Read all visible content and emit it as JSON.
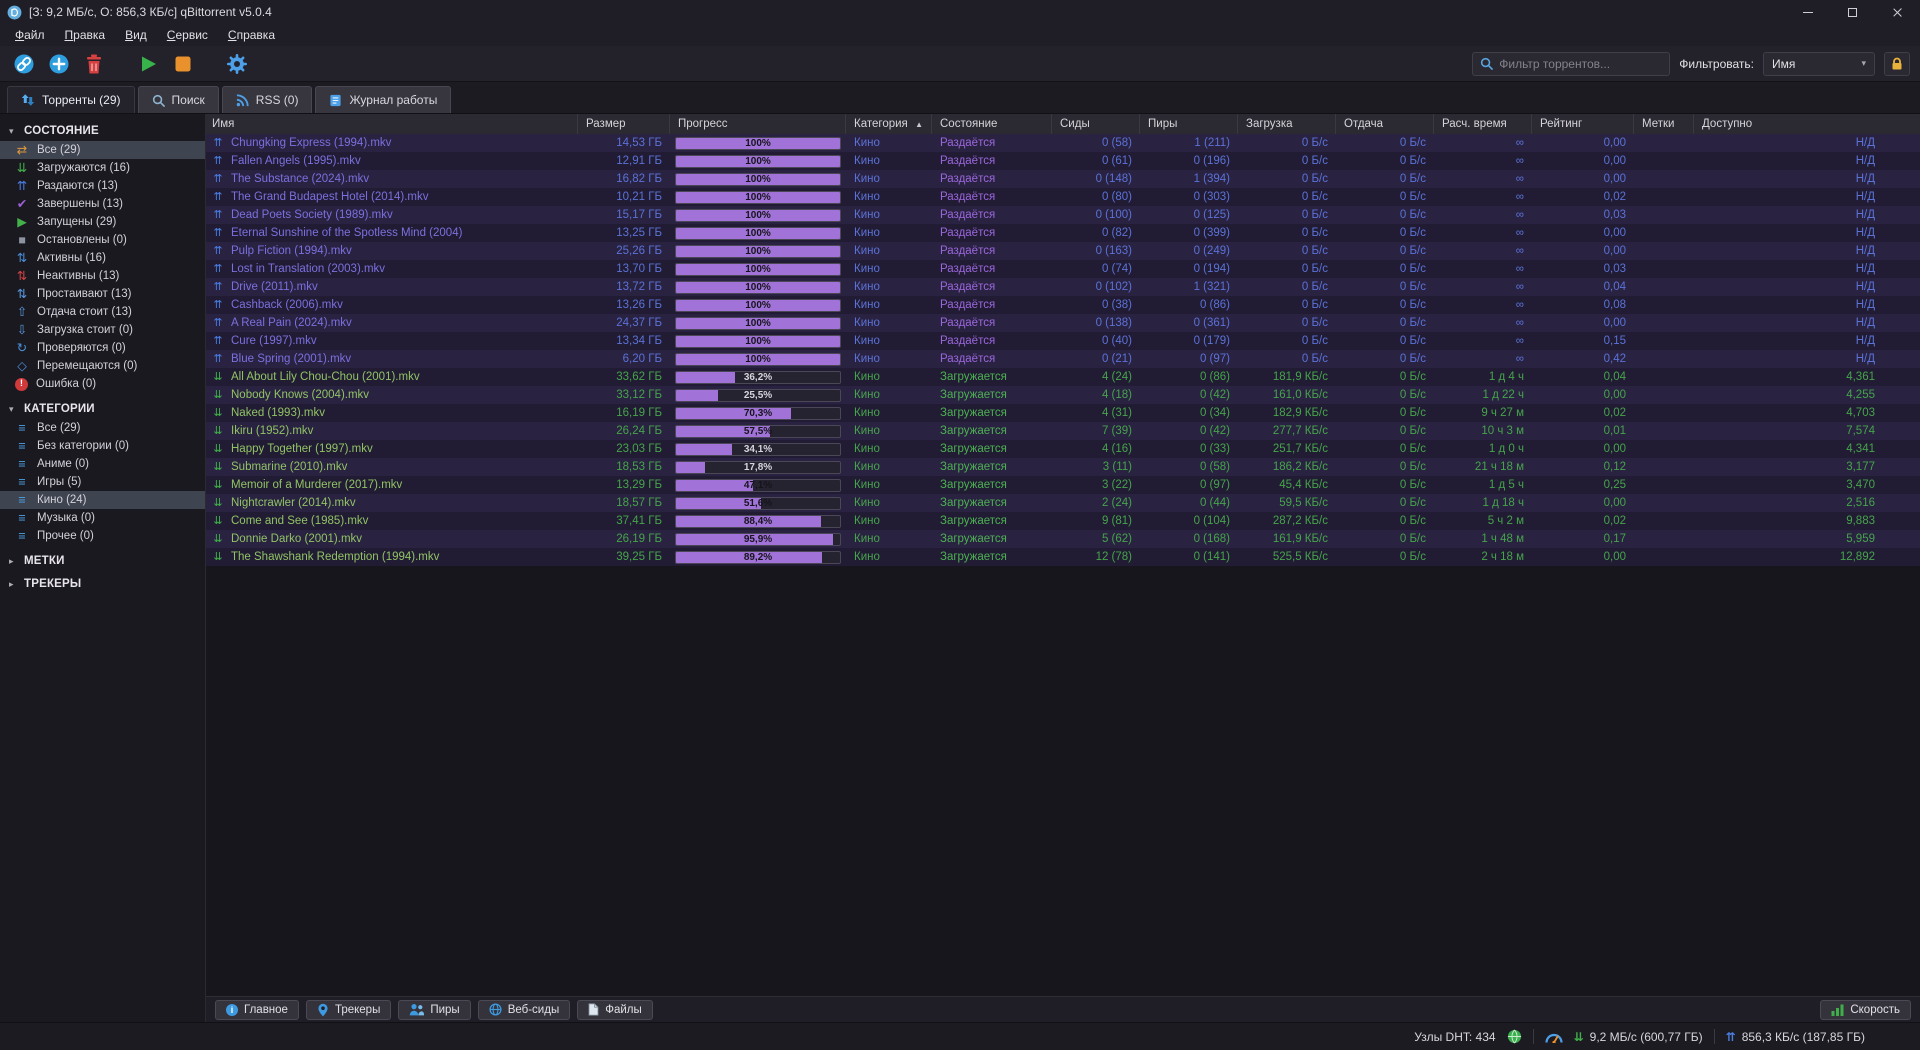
{
  "window": {
    "title": "[З: 9,2 МБ/с, О: 856,3 КБ/с] qBittorrent v5.0.4"
  },
  "menu": {
    "file": "Файл",
    "edit": "Правка",
    "view": "Вид",
    "tools": "Сервис",
    "help": "Справка"
  },
  "toolbar": {
    "filter_placeholder": "Фильтр торрентов...",
    "filter_label": "Фильтровать:",
    "filter_by_value": "Имя"
  },
  "icons": {
    "chevron_down": "▾",
    "section_expanded": "▾",
    "section_collapsed": "▸"
  },
  "tabs": {
    "transfers": "Торренты (29)",
    "search": "Поиск",
    "rss": "RSS (0)",
    "log": "Журнал работы"
  },
  "sidebar": {
    "status": {
      "title": "СОСТОЯНИЕ",
      "items": [
        {
          "label": "Все (29)",
          "selected": true,
          "icon": {
            "name": "all-transfers-icon",
            "glyph": "⇄",
            "color": "#e09a3c"
          }
        },
        {
          "label": "Загружаются (16)",
          "icon": {
            "name": "downloading-icon",
            "glyph": "⇊",
            "color": "#43b049"
          }
        },
        {
          "label": "Раздаются (13)",
          "icon": {
            "name": "seeding-icon",
            "glyph": "⇈",
            "color": "#4a7ce0"
          }
        },
        {
          "label": "Завершены (13)",
          "icon": {
            "name": "completed-icon",
            "glyph": "✔",
            "color": "#9c5fd6"
          }
        },
        {
          "label": "Запущены (29)",
          "icon": {
            "name": "running-icon",
            "glyph": "▶",
            "color": "#43b049"
          }
        },
        {
          "label": "Остановлены (0)",
          "icon": {
            "name": "stopped-icon",
            "glyph": "■",
            "color": "#8d93a0"
          }
        },
        {
          "label": "Активны (16)",
          "icon": {
            "name": "active-icon",
            "glyph": "⇅",
            "color": "#4a90d9"
          }
        },
        {
          "label": "Неактивны (13)",
          "icon": {
            "name": "inactive-icon",
            "glyph": "⇅",
            "color": "#d04545"
          }
        },
        {
          "label": "Простаивают (13)",
          "icon": {
            "name": "stalled-icon",
            "glyph": "⇅",
            "color": "#5a9ae0"
          }
        },
        {
          "label": "Отдача стоит (13)",
          "icon": {
            "name": "stalled-uploading-icon",
            "glyph": "⇧",
            "color": "#5a9ae0"
          }
        },
        {
          "label": "Загрузка стоит (0)",
          "icon": {
            "name": "stalled-downloading-icon",
            "glyph": "⇩",
            "color": "#5a9ae0"
          }
        },
        {
          "label": "Проверяются (0)",
          "icon": {
            "name": "checking-icon",
            "glyph": "↻",
            "color": "#4a90d9"
          }
        },
        {
          "label": "Перемещаются (0)",
          "icon": {
            "name": "moving-icon",
            "glyph": "◇",
            "color": "#4a90d9"
          }
        },
        {
          "label": "Ошибка (0)",
          "icon": {
            "name": "error-icon",
            "glyph": "!",
            "color": "#ffffff",
            "bg": "#d03a3a"
          }
        }
      ]
    },
    "categories": {
      "title": "КАТЕГОРИИ",
      "items": [
        {
          "label": "Все (29)",
          "icon": {
            "name": "category-icon",
            "glyph": "≡",
            "color": "#4da3e8"
          }
        },
        {
          "label": "Без категории (0)",
          "icon": {
            "name": "category-icon",
            "glyph": "≡",
            "color": "#4da3e8"
          }
        },
        {
          "label": "Аниме (0)",
          "icon": {
            "name": "category-icon",
            "glyph": "≡",
            "color": "#4da3e8"
          }
        },
        {
          "label": "Игры (5)",
          "icon": {
            "name": "category-icon",
            "glyph": "≡",
            "color": "#4da3e8"
          }
        },
        {
          "label": "Кино (24)",
          "selected": true,
          "icon": {
            "name": "category-icon",
            "glyph": "≡",
            "color": "#4da3e8"
          }
        },
        {
          "label": "Музыка (0)",
          "icon": {
            "name": "category-icon",
            "glyph": "≡",
            "color": "#4da3e8"
          }
        },
        {
          "label": "Прочее (0)",
          "icon": {
            "name": "category-icon",
            "glyph": "≡",
            "color": "#4da3e8"
          }
        }
      ]
    },
    "tags": {
      "title": "МЕТКИ"
    },
    "trackers": {
      "title": "ТРЕКЕРЫ"
    }
  },
  "table": {
    "columns": [
      {
        "label": "Имя"
      },
      {
        "label": "Размер",
        "type": "right"
      },
      {
        "label": "Прогресс"
      },
      {
        "label": "Категория",
        "sort": "▲"
      },
      {
        "label": "Состояние"
      },
      {
        "label": "Сиды",
        "type": "right"
      },
      {
        "label": "Пиры",
        "type": "right"
      },
      {
        "label": "Загрузка",
        "type": "right"
      },
      {
        "label": "Отдача",
        "type": "right"
      },
      {
        "label": "Расч. время",
        "type": "right"
      },
      {
        "label": "Рейтинг",
        "type": "right"
      },
      {
        "label": "Метки"
      },
      {
        "label": "Доступно",
        "type": "right"
      }
    ],
    "rows": [
      {
        "type": "seeding",
        "name": "Chungking Express (1994).mkv",
        "size": "14,53 ГБ",
        "progress": 100,
        "progress_label": "100%",
        "category": "Кино",
        "state": "Раздаётся",
        "seeds": "0 (58)",
        "peers": "1 (211)",
        "down": "0 Б/с",
        "up": "0 Б/с",
        "eta": "∞",
        "ratio": "0,00",
        "tags": "",
        "avail": "Н/Д"
      },
      {
        "type": "seeding",
        "name": "Fallen Angels (1995).mkv",
        "size": "12,91 ГБ",
        "progress": 100,
        "progress_label": "100%",
        "category": "Кино",
        "state": "Раздаётся",
        "seeds": "0 (61)",
        "peers": "0 (196)",
        "down": "0 Б/с",
        "up": "0 Б/с",
        "eta": "∞",
        "ratio": "0,00",
        "tags": "",
        "avail": "Н/Д"
      },
      {
        "type": "seeding",
        "name": "The Substance (2024).mkv",
        "size": "16,82 ГБ",
        "progress": 100,
        "progress_label": "100%",
        "category": "Кино",
        "state": "Раздаётся",
        "seeds": "0 (148)",
        "peers": "1 (394)",
        "down": "0 Б/с",
        "up": "0 Б/с",
        "eta": "∞",
        "ratio": "0,00",
        "tags": "",
        "avail": "Н/Д"
      },
      {
        "type": "seeding",
        "name": "The Grand Budapest Hotel (2014).mkv",
        "size": "10,21 ГБ",
        "progress": 100,
        "progress_label": "100%",
        "category": "Кино",
        "state": "Раздаётся",
        "seeds": "0 (80)",
        "peers": "0 (303)",
        "down": "0 Б/с",
        "up": "0 Б/с",
        "eta": "∞",
        "ratio": "0,02",
        "tags": "",
        "avail": "Н/Д"
      },
      {
        "type": "seeding",
        "name": "Dead Poets Society (1989).mkv",
        "size": "15,17 ГБ",
        "progress": 100,
        "progress_label": "100%",
        "category": "Кино",
        "state": "Раздаётся",
        "seeds": "0 (100)",
        "peers": "0 (125)",
        "down": "0 Б/с",
        "up": "0 Б/с",
        "eta": "∞",
        "ratio": "0,03",
        "tags": "",
        "avail": "Н/Д"
      },
      {
        "type": "seeding",
        "name": "Eternal Sunshine of the Spotless Mind (2004)",
        "size": "13,25 ГБ",
        "progress": 100,
        "progress_label": "100%",
        "category": "Кино",
        "state": "Раздаётся",
        "seeds": "0 (82)",
        "peers": "0 (399)",
        "down": "0 Б/с",
        "up": "0 Б/с",
        "eta": "∞",
        "ratio": "0,00",
        "tags": "",
        "avail": "Н/Д"
      },
      {
        "type": "seeding",
        "name": "Pulp Fiction (1994).mkv",
        "size": "25,26 ГБ",
        "progress": 100,
        "progress_label": "100%",
        "category": "Кино",
        "state": "Раздаётся",
        "seeds": "0 (163)",
        "peers": "0 (249)",
        "down": "0 Б/с",
        "up": "0 Б/с",
        "eta": "∞",
        "ratio": "0,00",
        "tags": "",
        "avail": "Н/Д"
      },
      {
        "type": "seeding",
        "name": "Lost in Translation (2003).mkv",
        "size": "13,70 ГБ",
        "progress": 100,
        "progress_label": "100%",
        "category": "Кино",
        "state": "Раздаётся",
        "seeds": "0 (74)",
        "peers": "0 (194)",
        "down": "0 Б/с",
        "up": "0 Б/с",
        "eta": "∞",
        "ratio": "0,03",
        "tags": "",
        "avail": "Н/Д"
      },
      {
        "type": "seeding",
        "name": "Drive (2011).mkv",
        "size": "13,72 ГБ",
        "progress": 100,
        "progress_label": "100%",
        "category": "Кино",
        "state": "Раздаётся",
        "seeds": "0 (102)",
        "peers": "1 (321)",
        "down": "0 Б/с",
        "up": "0 Б/с",
        "eta": "∞",
        "ratio": "0,04",
        "tags": "",
        "avail": "Н/Д"
      },
      {
        "type": "seeding",
        "name": "Cashback (2006).mkv",
        "size": "13,26 ГБ",
        "progress": 100,
        "progress_label": "100%",
        "category": "Кино",
        "state": "Раздаётся",
        "seeds": "0 (38)",
        "peers": "0 (86)",
        "down": "0 Б/с",
        "up": "0 Б/с",
        "eta": "∞",
        "ratio": "0,08",
        "tags": "",
        "avail": "Н/Д"
      },
      {
        "type": "seeding",
        "name": "A Real Pain (2024).mkv",
        "size": "24,37 ГБ",
        "progress": 100,
        "progress_label": "100%",
        "category": "Кино",
        "state": "Раздаётся",
        "seeds": "0 (138)",
        "peers": "0 (361)",
        "down": "0 Б/с",
        "up": "0 Б/с",
        "eta": "∞",
        "ratio": "0,00",
        "tags": "",
        "avail": "Н/Д"
      },
      {
        "type": "seeding",
        "name": "Cure (1997).mkv",
        "size": "13,34 ГБ",
        "progress": 100,
        "progress_label": "100%",
        "category": "Кино",
        "state": "Раздаётся",
        "seeds": "0 (40)",
        "peers": "0 (179)",
        "down": "0 Б/с",
        "up": "0 Б/с",
        "eta": "∞",
        "ratio": "0,15",
        "tags": "",
        "avail": "Н/Д"
      },
      {
        "type": "seeding",
        "name": "Blue Spring (2001).mkv",
        "size": "6,20 ГБ",
        "progress": 100,
        "progress_label": "100%",
        "category": "Кино",
        "state": "Раздаётся",
        "seeds": "0 (21)",
        "peers": "0 (97)",
        "down": "0 Б/с",
        "up": "0 Б/с",
        "eta": "∞",
        "ratio": "0,42",
        "tags": "",
        "avail": "Н/Д"
      },
      {
        "type": "downloading",
        "name": "All About Lily Chou-Chou (2001).mkv",
        "size": "33,62 ГБ",
        "progress": 36.2,
        "progress_label": "36,2%",
        "category": "Кино",
        "state": "Загружается",
        "seeds": "4 (24)",
        "peers": "0 (86)",
        "down": "181,9 КБ/с",
        "up": "0 Б/с",
        "eta": "1 д 4 ч",
        "ratio": "0,04",
        "tags": "",
        "avail": "4,361"
      },
      {
        "type": "downloading",
        "name": "Nobody Knows (2004).mkv",
        "size": "33,12 ГБ",
        "progress": 25.5,
        "progress_label": "25,5%",
        "category": "Кино",
        "state": "Загружается",
        "seeds": "4 (18)",
        "peers": "0 (42)",
        "down": "161,0 КБ/с",
        "up": "0 Б/с",
        "eta": "1 д 22 ч",
        "ratio": "0,00",
        "tags": "",
        "avail": "4,255"
      },
      {
        "type": "downloading",
        "name": "Naked (1993).mkv",
        "size": "16,19 ГБ",
        "progress": 70.3,
        "progress_label": "70,3%",
        "category": "Кино",
        "state": "Загружается",
        "seeds": "4 (31)",
        "peers": "0 (34)",
        "down": "182,9 КБ/с",
        "up": "0 Б/с",
        "eta": "9 ч 27 м",
        "ratio": "0,02",
        "tags": "",
        "avail": "4,703"
      },
      {
        "type": "downloading",
        "name": "Ikiru (1952).mkv",
        "size": "26,24 ГБ",
        "progress": 57.5,
        "progress_label": "57,5%",
        "category": "Кино",
        "state": "Загружается",
        "seeds": "7 (39)",
        "peers": "0 (42)",
        "down": "277,7 КБ/с",
        "up": "0 Б/с",
        "eta": "10 ч 3 м",
        "ratio": "0,01",
        "tags": "",
        "avail": "7,574"
      },
      {
        "type": "downloading",
        "name": "Happy Together (1997).mkv",
        "size": "23,03 ГБ",
        "progress": 34.1,
        "progress_label": "34,1%",
        "category": "Кино",
        "state": "Загружается",
        "seeds": "4 (16)",
        "peers": "0 (33)",
        "down": "251,7 КБ/с",
        "up": "0 Б/с",
        "eta": "1 д 0 ч",
        "ratio": "0,00",
        "tags": "",
        "avail": "4,341"
      },
      {
        "type": "downloading",
        "name": "Submarine (2010).mkv",
        "size": "18,53 ГБ",
        "progress": 17.8,
        "progress_label": "17,8%",
        "category": "Кино",
        "state": "Загружается",
        "seeds": "3 (11)",
        "peers": "0 (58)",
        "down": "186,2 КБ/с",
        "up": "0 Б/с",
        "eta": "21 ч 18 м",
        "ratio": "0,12",
        "tags": "",
        "avail": "3,177"
      },
      {
        "type": "downloading",
        "name": "Memoir of a Murderer (2017).mkv",
        "size": "13,29 ГБ",
        "progress": 47.1,
        "progress_label": "47,1%",
        "category": "Кино",
        "state": "Загружается",
        "seeds": "3 (22)",
        "peers": "0 (97)",
        "down": "45,4 КБ/с",
        "up": "0 Б/с",
        "eta": "1 д 5 ч",
        "ratio": "0,25",
        "tags": "",
        "avail": "3,470"
      },
      {
        "type": "downloading",
        "name": "Nightcrawler (2014).mkv",
        "size": "18,57 ГБ",
        "progress": 51.6,
        "progress_label": "51,6%",
        "category": "Кино",
        "state": "Загружается",
        "seeds": "2 (24)",
        "peers": "0 (44)",
        "down": "59,5 КБ/с",
        "up": "0 Б/с",
        "eta": "1 д 18 ч",
        "ratio": "0,00",
        "tags": "",
        "avail": "2,516"
      },
      {
        "type": "downloading",
        "name": "Come and See (1985).mkv",
        "size": "37,41 ГБ",
        "progress": 88.4,
        "progress_label": "88,4%",
        "category": "Кино",
        "state": "Загружается",
        "seeds": "9 (81)",
        "peers": "0 (104)",
        "down": "287,2 КБ/с",
        "up": "0 Б/с",
        "eta": "5 ч 2 м",
        "ratio": "0,02",
        "tags": "",
        "avail": "9,883"
      },
      {
        "type": "downloading",
        "name": "Donnie Darko (2001).mkv",
        "size": "26,19 ГБ",
        "progress": 95.9,
        "progress_label": "95,9%",
        "category": "Кино",
        "state": "Загружается",
        "seeds": "5 (62)",
        "peers": "0 (168)",
        "down": "161,9 КБ/с",
        "up": "0 Б/с",
        "eta": "1 ч 48 м",
        "ratio": "0,17",
        "tags": "",
        "avail": "5,959"
      },
      {
        "type": "downloading",
        "name": "The Shawshank Redemption (1994).mkv",
        "size": "39,25 ГБ",
        "progress": 89.2,
        "progress_label": "89,2%",
        "category": "Кино",
        "state": "Загружается",
        "seeds": "12 (78)",
        "peers": "0 (141)",
        "down": "525,5 КБ/с",
        "up": "0 Б/с",
        "eta": "2 ч 18 м",
        "ratio": "0,00",
        "tags": "",
        "avail": "12,892"
      }
    ]
  },
  "bottom_tabs": {
    "general": "Главное",
    "trackers": "Трекеры",
    "peers": "Пиры",
    "webseeds": "Веб-сиды",
    "files": "Файлы",
    "speed": "Скорость"
  },
  "statusbar": {
    "dht": "Узлы DHT: 434",
    "down_icon": "⇊",
    "down_speed": "9,2 МБ/с (600,77 ГБ)",
    "up_icon": "⇈",
    "up_speed": "856,3 КБ/с (187,85 ГБ)"
  }
}
